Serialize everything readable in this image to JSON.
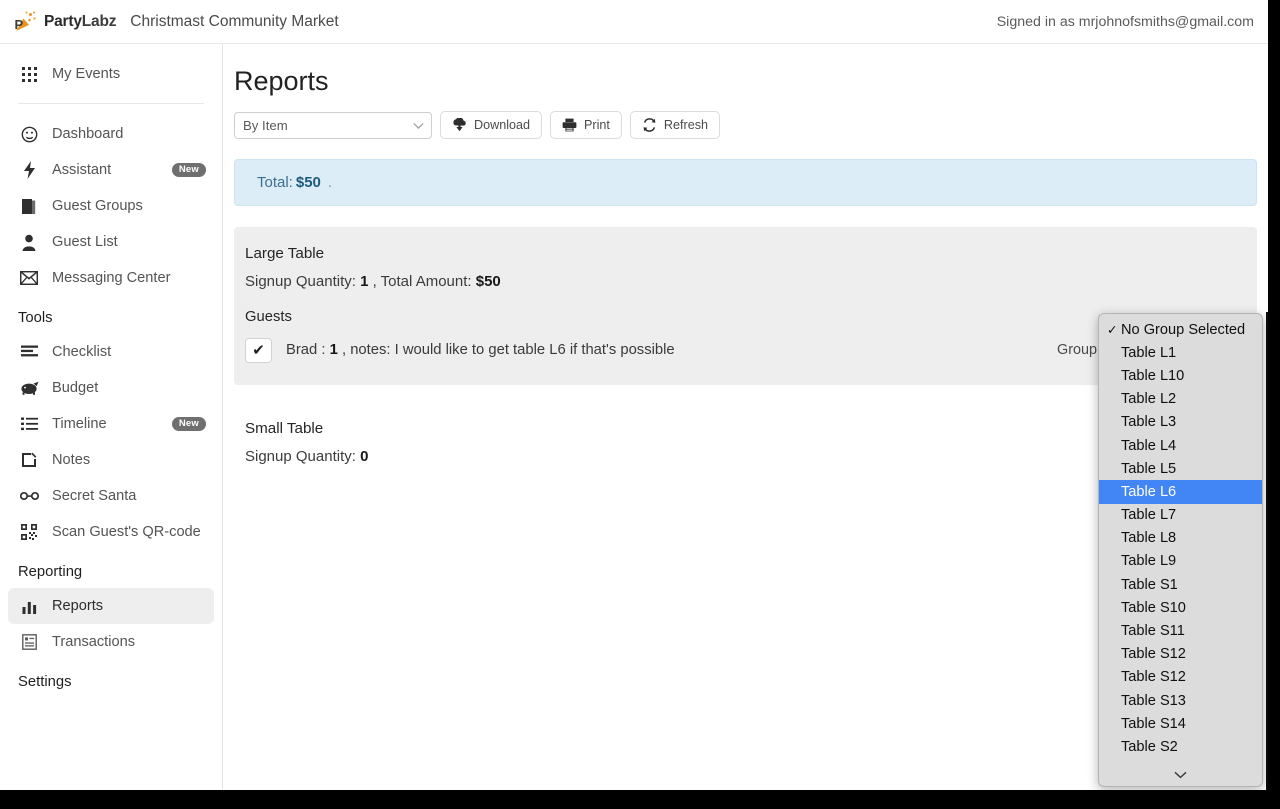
{
  "header": {
    "brand_name_party": "Party",
    "brand_name_labz": "Labz",
    "event_title": "Christmast Community Market",
    "signed_in": "Signed in as mrjohnofsmiths@gmail.com",
    "logo_icon": "party-popper-icon",
    "brand_color": "#e8941f"
  },
  "sidebar": {
    "top_items": [
      {
        "label": "My Events",
        "icon": "grid-icon",
        "active": false
      }
    ],
    "primary_items": [
      {
        "label": "Dashboard",
        "icon": "dashboard-gauge-icon",
        "badge": "",
        "active": false
      },
      {
        "label": "Assistant",
        "icon": "lightning-bolt-icon",
        "badge": "New",
        "active": false
      },
      {
        "label": "Guest Groups",
        "icon": "book-icon",
        "badge": "",
        "active": false
      },
      {
        "label": "Guest List",
        "icon": "person-icon",
        "badge": "",
        "active": false
      },
      {
        "label": "Messaging Center",
        "icon": "envelope-icon",
        "badge": "",
        "active": false
      }
    ],
    "tools_section": "Tools",
    "tools_items": [
      {
        "label": "Checklist",
        "icon": "checklist-icon",
        "badge": "",
        "active": false
      },
      {
        "label": "Budget",
        "icon": "piggy-bank-icon",
        "badge": "",
        "active": false
      },
      {
        "label": "Timeline",
        "icon": "list-icon",
        "badge": "New",
        "active": false
      },
      {
        "label": "Notes",
        "icon": "note-edit-icon",
        "badge": "",
        "active": false
      },
      {
        "label": "Secret Santa",
        "icon": "glasses-icon",
        "badge": "",
        "active": false
      },
      {
        "label": "Scan Guest's QR-code",
        "icon": "qr-code-icon",
        "badge": "",
        "active": false
      }
    ],
    "reporting_section": "Reporting",
    "reporting_items": [
      {
        "label": "Reports",
        "icon": "bar-chart-icon",
        "badge": "",
        "active": true
      },
      {
        "label": "Transactions",
        "icon": "receipt-icon",
        "badge": "",
        "active": false
      }
    ],
    "settings_section": "Settings"
  },
  "main": {
    "page_title": "Reports",
    "toolbar": {
      "report_type_value": "By Item",
      "download_label": "Download",
      "print_label": "Print",
      "refresh_label": "Refresh",
      "download_icon": "cloud-download-icon",
      "print_icon": "printer-icon",
      "refresh_icon": "refresh-icon"
    },
    "total_banner": {
      "label": "Total:",
      "amount": "$50",
      "suffix": "."
    },
    "items": [
      {
        "name": "Large Table",
        "quantity_label": "Signup Quantity:",
        "quantity": "1",
        "comma": ",",
        "amount_label": "Total Amount:",
        "amount": "$50",
        "guests_heading": "Guests",
        "guests": [
          {
            "checked": true,
            "check_glyph": "✔",
            "name": "Brad :",
            "quantity": "1",
            "notes": ", notes: I would like to get table L6 if that's possible",
            "group_label": "Group:",
            "group_value": "No Group Selected"
          }
        ]
      },
      {
        "name": "Small Table",
        "quantity_label": "Signup Quantity:",
        "quantity": "0",
        "comma": "",
        "amount_label": "",
        "amount": "",
        "guests_heading": "",
        "guests": []
      }
    ]
  },
  "dropdown": {
    "open": true,
    "selected_option": "Table L6",
    "checked_option": "No Group Selected",
    "highlight_color": "#4285f4",
    "options": [
      "No Group Selected",
      "Table L1",
      "Table L10",
      "Table L2",
      "Table L3",
      "Table L4",
      "Table L5",
      "Table L6",
      "Table L7",
      "Table L8",
      "Table L9",
      "Table S1",
      "Table S10",
      "Table S11",
      "Table S12",
      "Table S12",
      "Table S13",
      "Table S14",
      "Table S2"
    ],
    "scroll_down_icon": "chevron-down-icon"
  }
}
